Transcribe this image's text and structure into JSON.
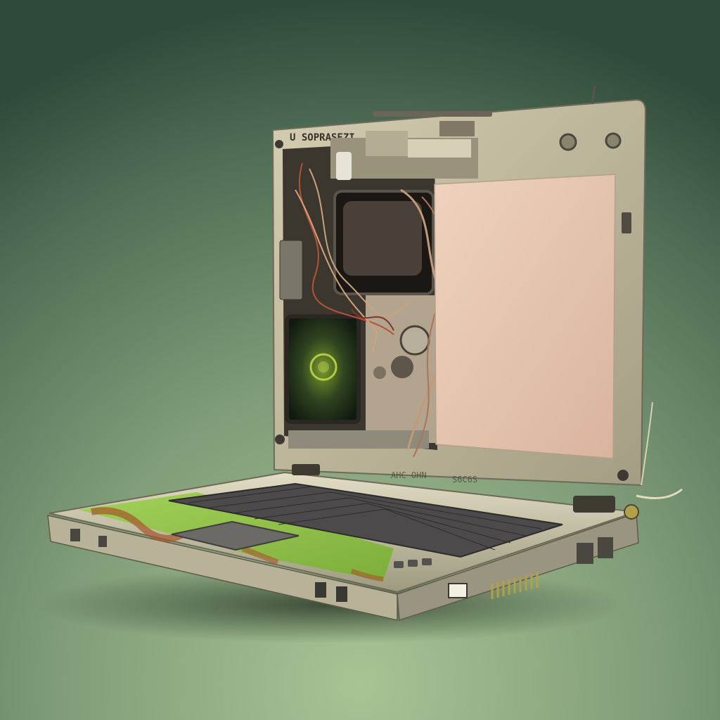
{
  "scene": {
    "subject": "laptop",
    "lid_marking": "U SOPRASEZI",
    "hinge_marking_left": "AHC OHN",
    "hinge_marking_right": "S6C6S",
    "colors": {
      "background_top": "#2f4a3a",
      "background_mid": "#5d7a60",
      "background_floor": "#a9c394",
      "shell": "#c8c2a8",
      "shell_dark": "#8d8872",
      "screen_panel": "#e8c9b3",
      "keyboard": "#4c4a4b",
      "palmrest_green": "#8cbf45",
      "rust": "#a5562a",
      "crt_glow": "#a8c64a"
    }
  }
}
